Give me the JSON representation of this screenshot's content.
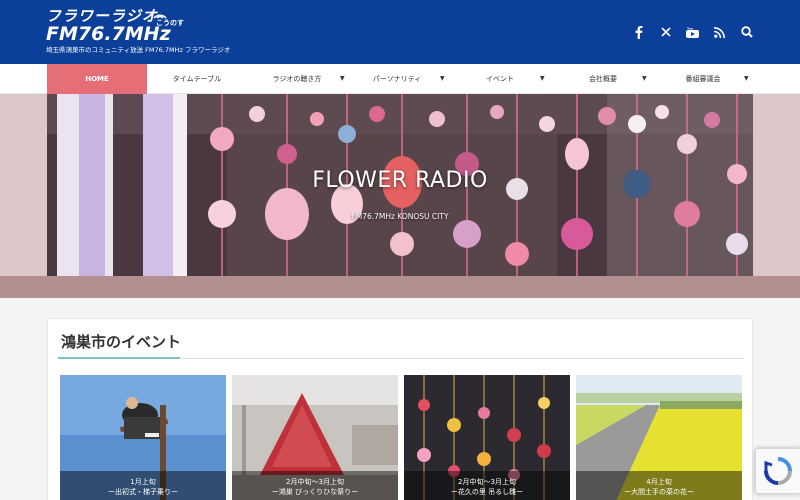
{
  "header": {
    "logo_line1": "フラワーラジオ",
    "logo_badge": "こうのす",
    "logo_line2": "FM76.7MHz",
    "logo_sub": "埼玉県鴻巣市のコミュニティ放送 FM76.7MHz フラワーラジオ",
    "social": [
      {
        "icon": "facebook-icon",
        "glyph": "f"
      },
      {
        "icon": "x-twitter-icon",
        "glyph": "𝕏"
      },
      {
        "icon": "youtube-icon",
        "glyph": "▶"
      },
      {
        "icon": "rss-icon",
        "glyph": "RSS"
      },
      {
        "icon": "search-icon",
        "glyph": "search"
      }
    ]
  },
  "nav": {
    "items": [
      {
        "label": "HOME",
        "active": true
      },
      {
        "label": "タイムテーブル"
      },
      {
        "label": "ラジオの聴き方"
      },
      {
        "label": "パーソナリティ"
      },
      {
        "label": "イベント"
      },
      {
        "label": "会社概要"
      },
      {
        "label": "番組審議会"
      }
    ],
    "accent_color": "#e56e77"
  },
  "hero": {
    "title": "FLOWER RADIO",
    "subtitle": "FM76.7MHz KONOSU CITY"
  },
  "events": {
    "title": "鴻巣市のイベント",
    "items": [
      {
        "date": "1月上旬",
        "name": "ー出初式・梯子乗りー"
      },
      {
        "date": "2月中旬～3月上旬",
        "name": "ー鴻巣 びっくりひな祭りー"
      },
      {
        "date": "2月中旬～3月上旬",
        "name": "ー花久の里 吊るし雛ー"
      },
      {
        "date": "4月上旬",
        "name": "ー大間土手の菜の花ー"
      }
    ]
  },
  "colors": {
    "header_bg": "#0b3f99",
    "hero_band": "#dcc8c8",
    "underline": "#7ec0c8"
  }
}
